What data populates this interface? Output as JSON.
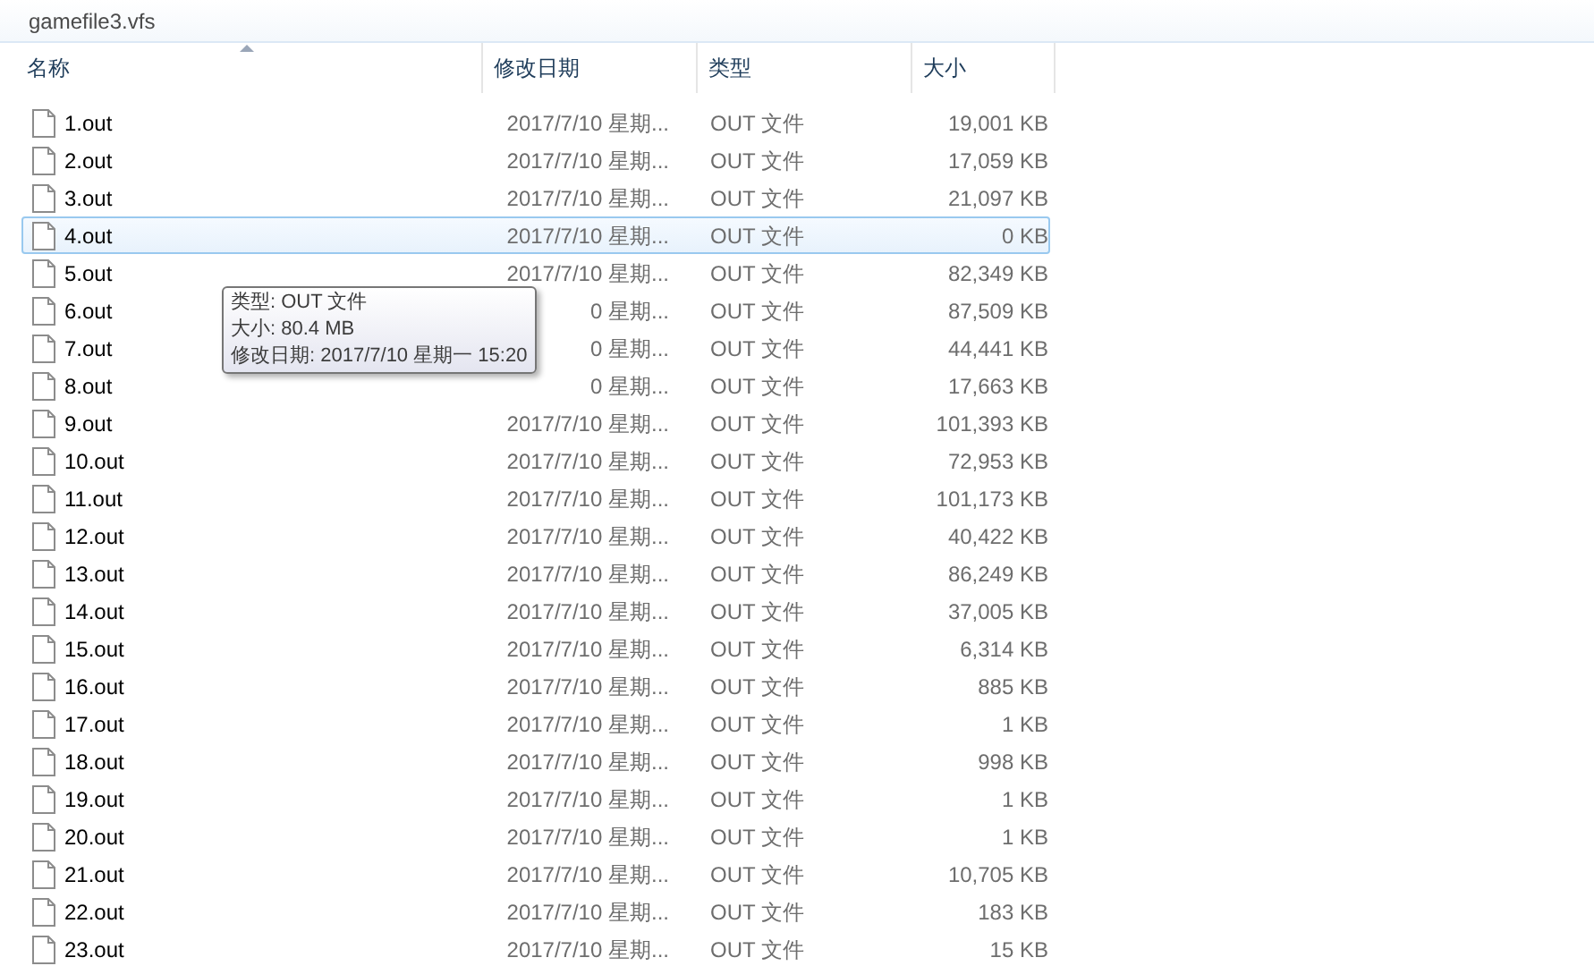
{
  "window": {
    "title": "gamefile3.vfs"
  },
  "columns": [
    {
      "label": "名称",
      "sorted": true
    },
    {
      "label": "修改日期",
      "sorted": false
    },
    {
      "label": "类型",
      "sorted": false
    },
    {
      "label": "大小",
      "sorted": false
    }
  ],
  "rows": [
    {
      "name": "1.out",
      "date": "2017/7/10 星期...",
      "type": "OUT 文件",
      "size": "19,001 KB",
      "selected": false
    },
    {
      "name": "2.out",
      "date": "2017/7/10 星期...",
      "type": "OUT 文件",
      "size": "17,059 KB",
      "selected": false
    },
    {
      "name": "3.out",
      "date": "2017/7/10 星期...",
      "type": "OUT 文件",
      "size": "21,097 KB",
      "selected": false
    },
    {
      "name": "4.out",
      "date": "2017/7/10 星期...",
      "type": "OUT 文件",
      "size": "0 KB",
      "selected": true
    },
    {
      "name": "5.out",
      "date": "2017/7/10 星期...",
      "type": "OUT 文件",
      "size": "82,349 KB",
      "selected": false
    },
    {
      "name": "6.out",
      "date": "0 星期...",
      "type": "OUT 文件",
      "size": "87,509 KB",
      "selected": false
    },
    {
      "name": "7.out",
      "date": "0 星期...",
      "type": "OUT 文件",
      "size": "44,441 KB",
      "selected": false
    },
    {
      "name": "8.out",
      "date": "0 星期...",
      "type": "OUT 文件",
      "size": "17,663 KB",
      "selected": false
    },
    {
      "name": "9.out",
      "date": "2017/7/10 星期...",
      "type": "OUT 文件",
      "size": "101,393 KB",
      "selected": false
    },
    {
      "name": "10.out",
      "date": "2017/7/10 星期...",
      "type": "OUT 文件",
      "size": "72,953 KB",
      "selected": false
    },
    {
      "name": "11.out",
      "date": "2017/7/10 星期...",
      "type": "OUT 文件",
      "size": "101,173 KB",
      "selected": false
    },
    {
      "name": "12.out",
      "date": "2017/7/10 星期...",
      "type": "OUT 文件",
      "size": "40,422 KB",
      "selected": false
    },
    {
      "name": "13.out",
      "date": "2017/7/10 星期...",
      "type": "OUT 文件",
      "size": "86,249 KB",
      "selected": false
    },
    {
      "name": "14.out",
      "date": "2017/7/10 星期...",
      "type": "OUT 文件",
      "size": "37,005 KB",
      "selected": false
    },
    {
      "name": "15.out",
      "date": "2017/7/10 星期...",
      "type": "OUT 文件",
      "size": "6,314 KB",
      "selected": false
    },
    {
      "name": "16.out",
      "date": "2017/7/10 星期...",
      "type": "OUT 文件",
      "size": "885 KB",
      "selected": false
    },
    {
      "name": "17.out",
      "date": "2017/7/10 星期...",
      "type": "OUT 文件",
      "size": "1 KB",
      "selected": false
    },
    {
      "name": "18.out",
      "date": "2017/7/10 星期...",
      "type": "OUT 文件",
      "size": "998 KB",
      "selected": false
    },
    {
      "name": "19.out",
      "date": "2017/7/10 星期...",
      "type": "OUT 文件",
      "size": "1 KB",
      "selected": false
    },
    {
      "name": "20.out",
      "date": "2017/7/10 星期...",
      "type": "OUT 文件",
      "size": "1 KB",
      "selected": false
    },
    {
      "name": "21.out",
      "date": "2017/7/10 星期...",
      "type": "OUT 文件",
      "size": "10,705 KB",
      "selected": false
    },
    {
      "name": "22.out",
      "date": "2017/7/10 星期...",
      "type": "OUT 文件",
      "size": "183 KB",
      "selected": false
    },
    {
      "name": "23.out",
      "date": "2017/7/10 星期...",
      "type": "OUT 文件",
      "size": "15 KB",
      "selected": false
    }
  ],
  "tooltip": {
    "lines": [
      "类型: OUT 文件",
      "大小: 80.4 MB",
      "修改日期: 2017/7/10 星期一 15:20"
    ]
  }
}
